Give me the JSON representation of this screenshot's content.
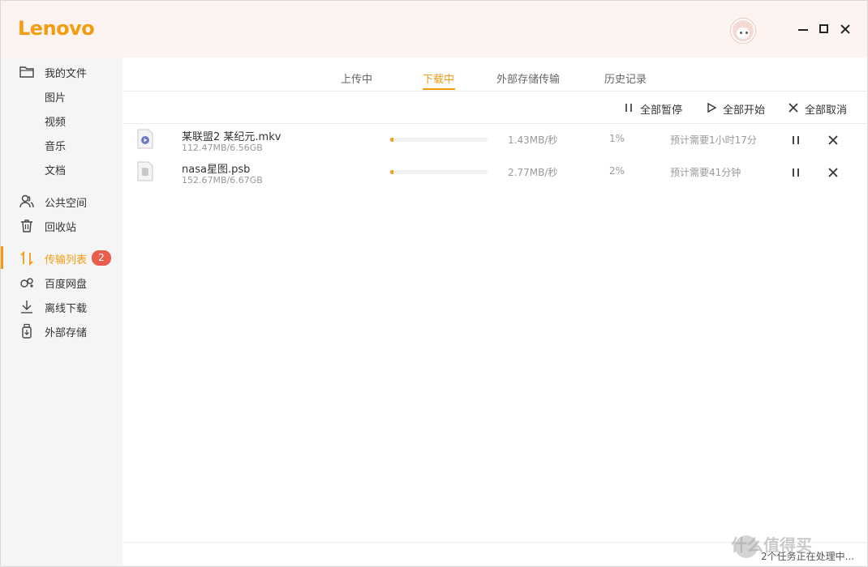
{
  "app": {
    "logo": "Lenovo",
    "accent_color": "#f39c12",
    "badge_color": "#e85d4e"
  },
  "window_controls": {
    "minimize": "minimize-icon",
    "maximize": "maximize-icon",
    "close": "close-icon"
  },
  "sidebar": {
    "items": [
      {
        "label": "我的文件",
        "icon": "folder-icon"
      },
      {
        "label": "图片"
      },
      {
        "label": "视频"
      },
      {
        "label": "音乐"
      },
      {
        "label": "文档"
      },
      {
        "label": "公共空间",
        "icon": "users-icon"
      },
      {
        "label": "回收站",
        "icon": "trash-icon"
      },
      {
        "label": "传输列表",
        "icon": "transfer-icon",
        "badge": "2",
        "active": true
      },
      {
        "label": "百度网盘",
        "icon": "baidu-cloud-icon"
      },
      {
        "label": "离线下载",
        "icon": "download-icon"
      },
      {
        "label": "外部存储",
        "icon": "usb-storage-icon"
      }
    ]
  },
  "tabs": [
    {
      "label": "上传中"
    },
    {
      "label": "下载中",
      "active": true
    },
    {
      "label": "外部存储传输"
    },
    {
      "label": "历史记录"
    }
  ],
  "toolbar": {
    "pause_all": "全部暂停",
    "start_all": "全部开始",
    "cancel_all": "全部取消"
  },
  "downloads": [
    {
      "name": "某联盟2 某纪元.mkv",
      "size": "112.47MB/6.56GB",
      "speed": "1.43MB/秒",
      "percent": "1%",
      "progress": 0.01,
      "eta": "预计需要1小时17分",
      "icon": "video-file-icon"
    },
    {
      "name": "nasa星图.psb",
      "size": "152.67MB/6.67GB",
      "speed": "2.77MB/秒",
      "percent": "2%",
      "progress": 0.02,
      "eta": "预计需要41分钟",
      "icon": "document-file-icon"
    }
  ],
  "status": {
    "text": "2个任务正在处理中..."
  },
  "watermark": "什么值得买"
}
